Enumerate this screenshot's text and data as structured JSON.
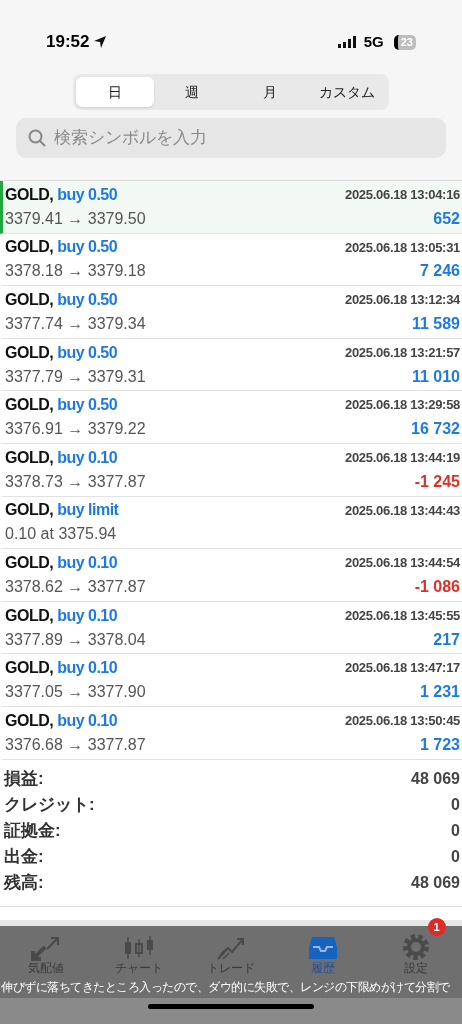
{
  "status_bar": {
    "time": "19:52",
    "network": "5G",
    "battery": "23"
  },
  "period_tabs": [
    {
      "label": "日",
      "selected": true
    },
    {
      "label": "週",
      "selected": false
    },
    {
      "label": "月",
      "selected": false
    },
    {
      "label": "カスタム",
      "selected": false
    }
  ],
  "search": {
    "placeholder": "検索シンボルを入力"
  },
  "deals": [
    {
      "symbol": "GOLD,",
      "action": "buy 0.50",
      "time": "2025.06.18 13:04:16",
      "detail": "3379.41 → 3379.50",
      "profit": "652",
      "color": "#1f7ae0",
      "selected": true
    },
    {
      "symbol": "GOLD,",
      "action": "buy 0.50",
      "time": "2025.06.18 13:05:31",
      "detail": "3378.18 → 3379.18",
      "profit": "7 246",
      "color": "#1f7ae0",
      "selected": false
    },
    {
      "symbol": "GOLD,",
      "action": "buy 0.50",
      "time": "2025.06.18 13:12:34",
      "detail": "3377.74 → 3379.34",
      "profit": "11 589",
      "color": "#1f7ae0",
      "selected": false
    },
    {
      "symbol": "GOLD,",
      "action": "buy 0.50",
      "time": "2025.06.18 13:21:57",
      "detail": "3377.79 → 3379.31",
      "profit": "11 010",
      "color": "#1f7ae0",
      "selected": false
    },
    {
      "symbol": "GOLD,",
      "action": "buy 0.50",
      "time": "2025.06.18 13:29:58",
      "detail": "3376.91 → 3379.22",
      "profit": "16 732",
      "color": "#1f7ae0",
      "selected": false
    },
    {
      "symbol": "GOLD,",
      "action": "buy 0.10",
      "time": "2025.06.18 13:44:19",
      "detail": "3378.73 → 3377.87",
      "profit": "-1 245",
      "color": "#e0302a",
      "selected": false
    },
    {
      "symbol": "GOLD,",
      "action": "buy limit",
      "time": "2025.06.18 13:44:43",
      "detail": "0.10 at 3375.94",
      "selected": false
    },
    {
      "symbol": "GOLD,",
      "action": "buy 0.10",
      "time": "2025.06.18 13:44:54",
      "detail": "3378.62 → 3377.87",
      "profit": "-1 086",
      "color": "#e0302a",
      "selected": false
    },
    {
      "symbol": "GOLD,",
      "action": "buy 0.10",
      "time": "2025.06.18 13:45:55",
      "detail": "3377.89 → 3378.04",
      "profit": "217",
      "color": "#1f7ae0",
      "selected": false
    },
    {
      "symbol": "GOLD,",
      "action": "buy 0.10",
      "time": "2025.06.18 13:47:17",
      "detail": "3377.05 → 3377.90",
      "profit": "1 231",
      "color": "#1f7ae0",
      "selected": false
    },
    {
      "symbol": "GOLD,",
      "action": "buy 0.10",
      "time": "2025.06.18 13:50:45",
      "detail": "3376.68 → 3377.87",
      "profit": "1 723",
      "color": "#1f7ae0",
      "selected": false
    }
  ],
  "summary": [
    {
      "label": "損益:",
      "value": "48 069"
    },
    {
      "label": "クレジット:",
      "value": "0"
    },
    {
      "label": "証拠金:",
      "value": "0"
    },
    {
      "label": "出金:",
      "value": "0"
    },
    {
      "label": "残高:",
      "value": "48 069"
    }
  ],
  "tab_bar": [
    {
      "kind": "quotes",
      "label": "気配値",
      "selected": false
    },
    {
      "kind": "chart",
      "label": "チャート",
      "selected": false
    },
    {
      "kind": "trade",
      "label": "トレード",
      "selected": false
    },
    {
      "kind": "history",
      "label": "履歴",
      "selected": true
    },
    {
      "kind": "settings",
      "label": "設定",
      "selected": false,
      "badge": "1"
    }
  ],
  "caption": "伸びずに落ちてきたところ入ったので、ダウ的に失敗で、レンジの下限めがけて分割で"
}
